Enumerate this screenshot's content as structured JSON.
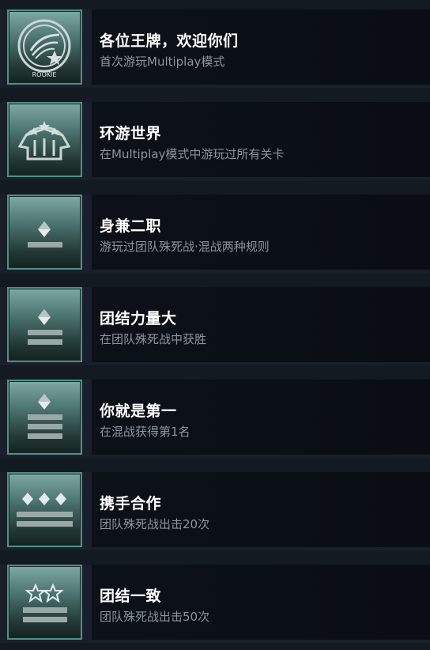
{
  "achievements": [
    {
      "title": "各位王牌，欢迎你们",
      "description": "首次游玩Multiplay模式",
      "badge_icon": "rookie-emblem",
      "emblem_text": "ROOKIE"
    },
    {
      "title": "环游世界",
      "description": "在Multiplay模式中游玩过所有关卡",
      "badge_icon": "circus-tent-emblem"
    },
    {
      "title": "身兼二职",
      "description": "游玩过团队殊死战·混战两种规则",
      "badge_icon": "rank-1-bar-icon"
    },
    {
      "title": "团结力量大",
      "description": "在团队殊死战中获胜",
      "badge_icon": "rank-2-bars-icon"
    },
    {
      "title": "你就是第一",
      "description": "在混战获得第1名",
      "badge_icon": "rank-3-bars-icon"
    },
    {
      "title": "携手合作",
      "description": "团队殊死战出击20次",
      "badge_icon": "rank-3-diamonds-2-bars-icon"
    },
    {
      "title": "团结一致",
      "description": "团队殊死战出击50次",
      "badge_icon": "rank-2-stars-2-bars-icon"
    }
  ],
  "colors": {
    "badge_border": "#4f8f86",
    "title": "#ffffff",
    "description": "#8d949c",
    "panel": "#0b1016"
  }
}
